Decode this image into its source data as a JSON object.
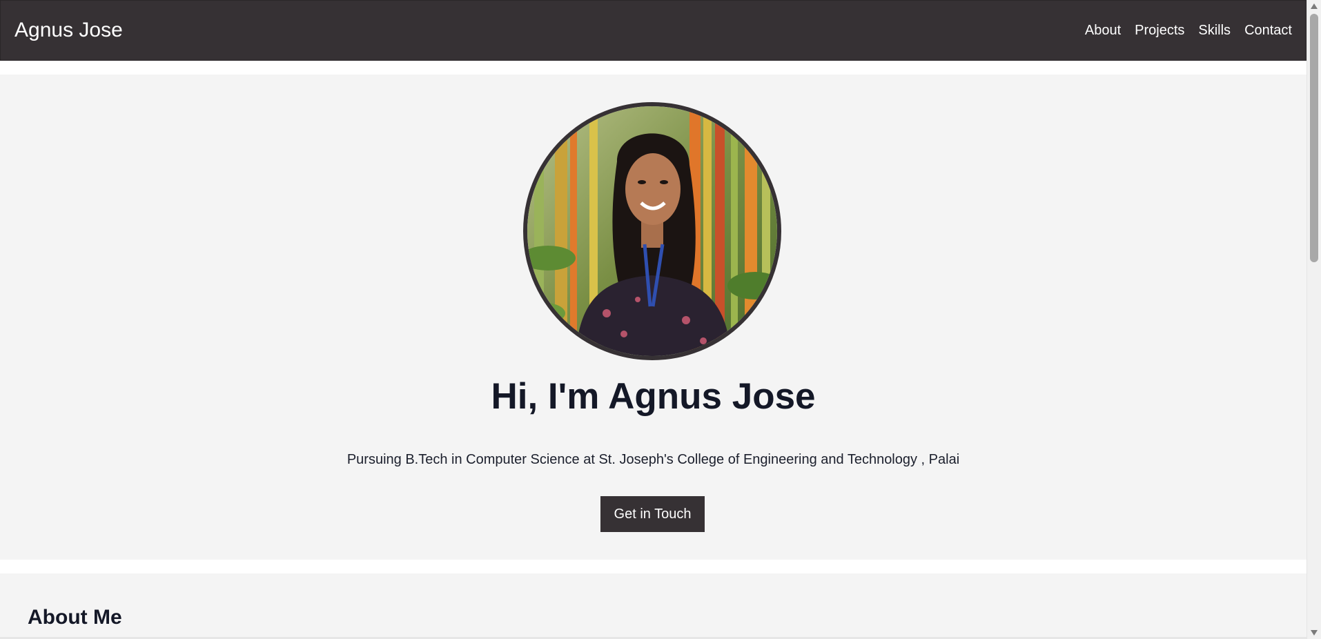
{
  "navbar": {
    "brand": "Agnus Jose",
    "links": [
      {
        "label": "About"
      },
      {
        "label": "Projects"
      },
      {
        "label": "Skills"
      },
      {
        "label": "Contact"
      }
    ]
  },
  "hero": {
    "title": "Hi, I'm Agnus Jose",
    "subtitle": "Pursuing B.Tech in Computer Science at St. Joseph's College of Engineering and Technology , Palai",
    "cta_label": "Get in Touch",
    "photo": "profile-photo"
  },
  "about": {
    "heading": "About Me"
  },
  "colors": {
    "navbar_bg": "#363134",
    "section_bg": "#f4f4f4",
    "heading_text": "#141827",
    "button_bg": "#363134"
  }
}
